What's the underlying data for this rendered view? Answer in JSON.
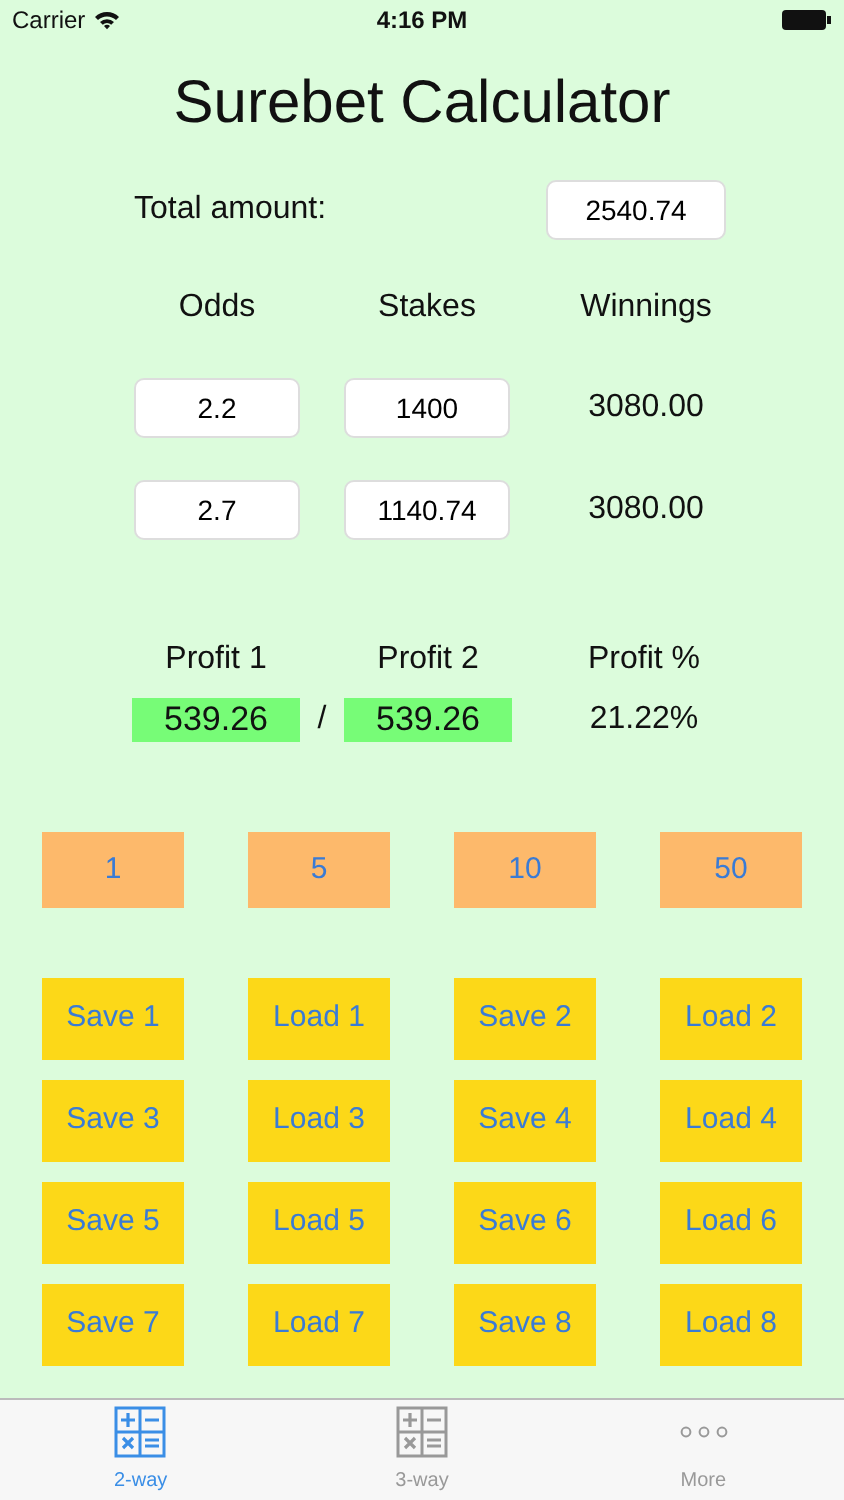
{
  "status_bar": {
    "carrier": "Carrier",
    "time": "4:16 PM"
  },
  "title": "Surebet Calculator",
  "total": {
    "label": "Total amount:",
    "value": "2540.74"
  },
  "columns": [
    "Odds",
    "Stakes",
    "Winnings"
  ],
  "rows": [
    {
      "odds": "2.2",
      "stake": "1400",
      "winnings": "3080.00"
    },
    {
      "odds": "2.7",
      "stake": "1140.74",
      "winnings": "3080.00"
    }
  ],
  "profit": {
    "headers": [
      "Profit 1",
      "Profit 2",
      "Profit %"
    ],
    "profit_1": "539.26",
    "separator": "/",
    "profit_2": "539.26",
    "percent": "21.22%"
  },
  "quick_buttons": [
    "1",
    "5",
    "10",
    "50"
  ],
  "slot_buttons": [
    "Save 1",
    "Load 1",
    "Save 2",
    "Load 2",
    "Save 3",
    "Load 3",
    "Save 4",
    "Load 4",
    "Save 5",
    "Load 5",
    "Save 6",
    "Load 6",
    "Save 7",
    "Load 7",
    "Save 8",
    "Load 8"
  ],
  "tabs": [
    {
      "label": "2-way",
      "kind": "grid",
      "selected": true
    },
    {
      "label": "3-way",
      "kind": "grid",
      "selected": false
    },
    {
      "label": "More",
      "kind": "dots",
      "selected": false
    }
  ]
}
